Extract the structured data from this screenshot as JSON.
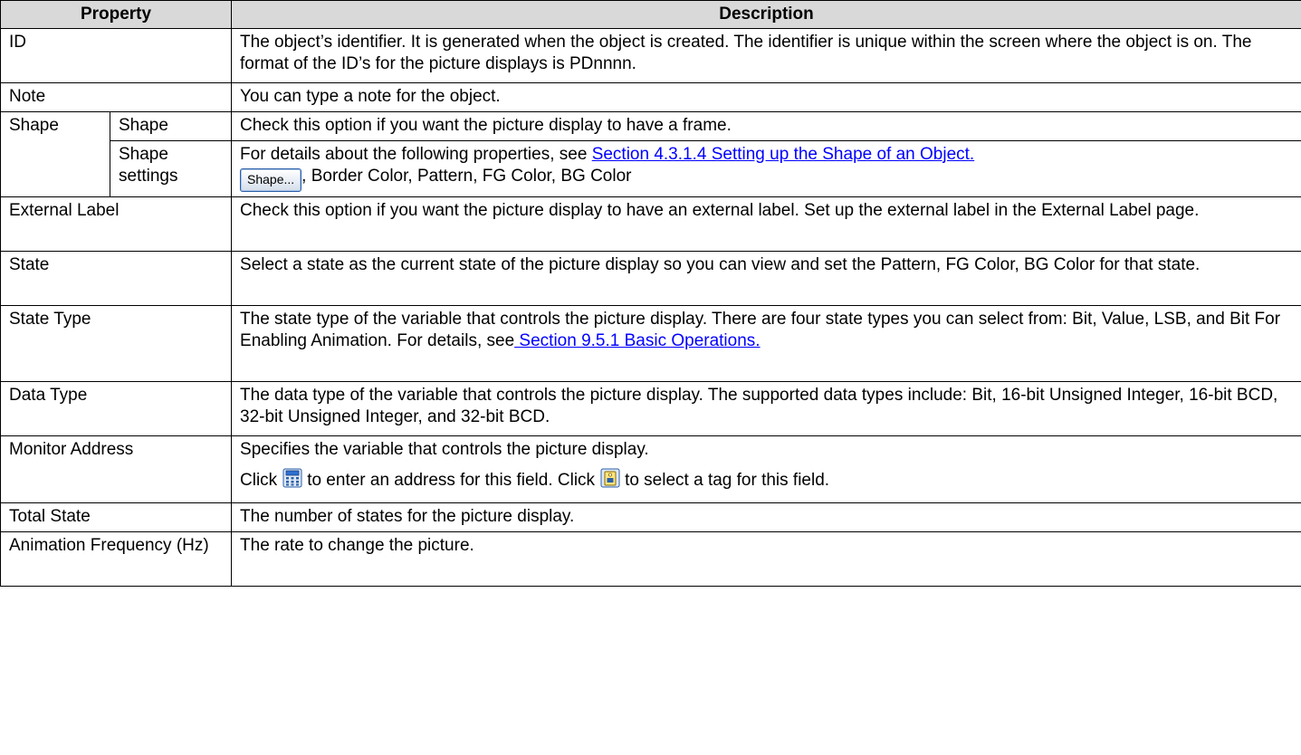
{
  "header": {
    "property": "Property",
    "description": "Description"
  },
  "rows": {
    "id": {
      "property": "ID",
      "description": "The object’s identifier. It is generated when the object is created. The identifier is unique within the screen where the object is on. The format of the ID’s for the picture displays is PDnnnn."
    },
    "note": {
      "property": "Note",
      "description": "You can type a note for the object."
    },
    "shape": {
      "property": "Shape",
      "shape": {
        "sub": "Shape",
        "description": "Check this option if you want the picture display to have a frame."
      },
      "settings": {
        "sub": "Shape settings",
        "text_before": "For details about the following properties, see ",
        "link": "Section 4.3.1.4 Setting up the Shape of an Object.",
        "button": "Shape...",
        "text_after": ", Border Color, Pattern, FG Color, BG Color"
      }
    },
    "external_label": {
      "property": "External Label",
      "description": "Check this option if you want the picture display to have an external label. Set up the external label in the External Label page."
    },
    "state": {
      "property": "State",
      "description": "Select a state as the current state of the picture display so you can view and set the Pattern, FG Color, BG Color for that state."
    },
    "state_type": {
      "property": "State Type",
      "text": "The state type of the variable that controls the picture display. There are four state types you can select from: Bit, Value, LSB, and Bit For Enabling Animation. For details, see",
      "link": " Section 9.5.1 Basic Operations."
    },
    "data_type": {
      "property": "Data Type",
      "description": "The data type of the variable that controls the picture display. The supported data types include: Bit, 16-bit Unsigned Integer, 16-bit BCD, 32-bit Unsigned Integer, and 32-bit BCD."
    },
    "monitor_address": {
      "property": "Monitor Address",
      "line1": "Specifies the variable that controls the picture display.",
      "click1": "Click",
      "after_icon1": "to enter an address for this field. Click",
      "after_icon2": "to select a tag for this field."
    },
    "total_state": {
      "property": "Total State",
      "description": "The number of states for the picture display."
    },
    "animation_frequency": {
      "property": "Animation Frequency (Hz)",
      "description": "The rate to change the picture."
    }
  },
  "colors": {
    "header_bg": "#d9d9d9",
    "link": "#0000ff",
    "border": "#000000"
  },
  "icons": [
    "calculator-icon",
    "tag-icon"
  ]
}
